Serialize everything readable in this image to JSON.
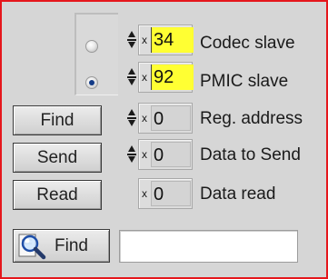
{
  "slave_select": {
    "options": [
      {
        "name": "codec",
        "selected": false
      },
      {
        "name": "pmic",
        "selected": true
      }
    ]
  },
  "fields": {
    "codec_slave": {
      "radix": "x",
      "value": "34",
      "label": "Codec slave"
    },
    "pmic_slave": {
      "radix": "x",
      "value": "92",
      "label": "PMIC slave"
    },
    "reg_address": {
      "radix": "x",
      "value": "0",
      "label": "Reg. address"
    },
    "data_to_send": {
      "radix": "x",
      "value": "0",
      "label": "Data to Send"
    },
    "data_read": {
      "radix": "x",
      "value": "0",
      "label": "Data read"
    }
  },
  "buttons": {
    "find": "Find",
    "send": "Send",
    "read": "Read",
    "find_search": "Find"
  },
  "result": {
    "value": ""
  },
  "colors": {
    "frame_border": "#e5171c",
    "panel_bg": "#d6d6d6",
    "highlight": "#ffff33",
    "radio_dot": "#123a86"
  },
  "icons": {
    "search": "magnifier-icon"
  }
}
